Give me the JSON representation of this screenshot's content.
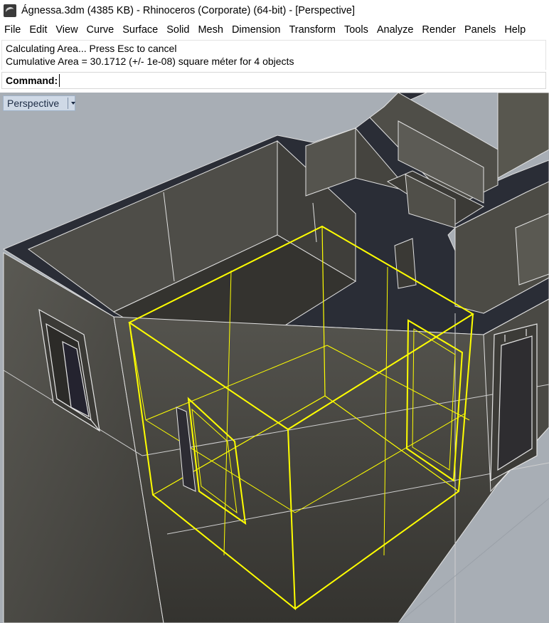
{
  "window": {
    "title": "Ágnessa.3dm (4385 KB) - Rhinoceros (Corporate) (64-bit) - [Perspective]",
    "icon": "rhino-app-icon"
  },
  "menu": [
    "File",
    "Edit",
    "View",
    "Curve",
    "Surface",
    "Solid",
    "Mesh",
    "Dimension",
    "Transform",
    "Tools",
    "Analyze",
    "Render",
    "Panels",
    "Help"
  ],
  "command_history": [
    "Calculating Area... Press Esc to cancel",
    "Cumulative Area = 30.1712 (+/- 1e-08) square méter for 4 objects"
  ],
  "command_line": {
    "label": "Command:",
    "value": ""
  },
  "viewport": {
    "name": "Perspective",
    "background": "#a8aeb5",
    "selection_color": "#ffff00",
    "wall_color": "#4a4944",
    "edge_color": "#e8e8e8"
  }
}
